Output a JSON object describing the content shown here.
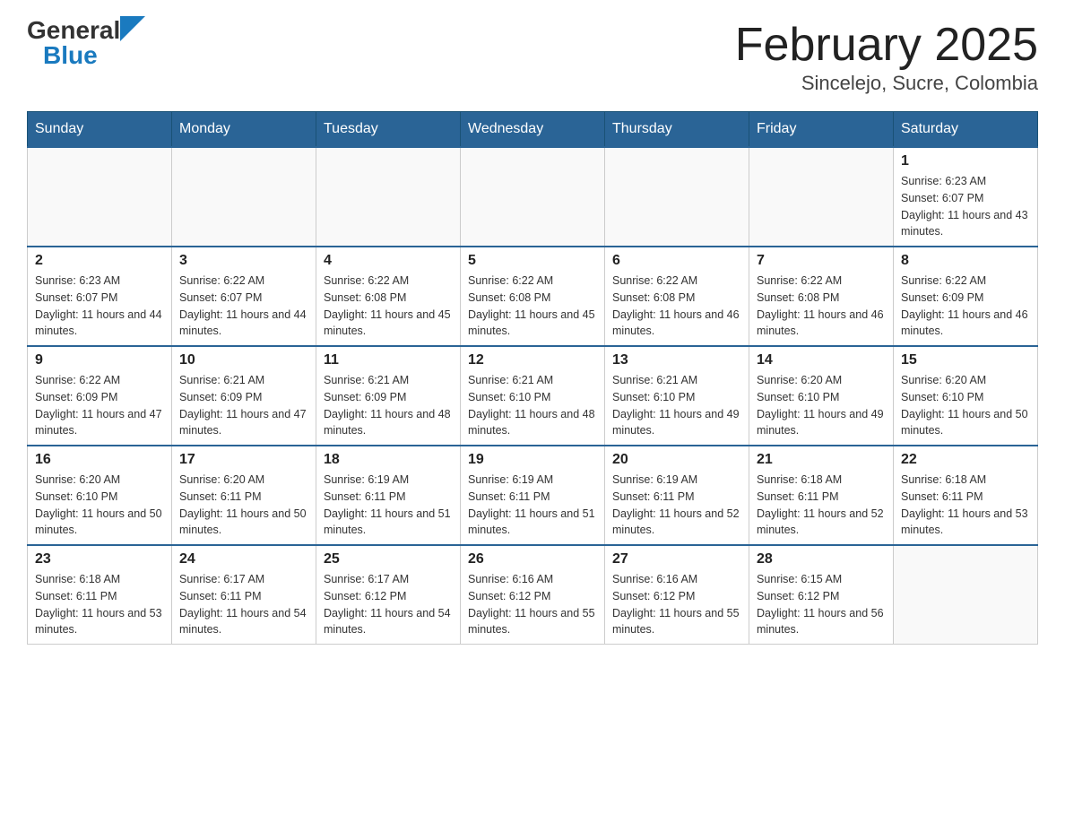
{
  "logo": {
    "general": "General",
    "blue": "Blue"
  },
  "title": "February 2025",
  "subtitle": "Sincelejo, Sucre, Colombia",
  "weekdays": [
    "Sunday",
    "Monday",
    "Tuesday",
    "Wednesday",
    "Thursday",
    "Friday",
    "Saturday"
  ],
  "weeks": [
    [
      {
        "day": "",
        "info": ""
      },
      {
        "day": "",
        "info": ""
      },
      {
        "day": "",
        "info": ""
      },
      {
        "day": "",
        "info": ""
      },
      {
        "day": "",
        "info": ""
      },
      {
        "day": "",
        "info": ""
      },
      {
        "day": "1",
        "info": "Sunrise: 6:23 AM\nSunset: 6:07 PM\nDaylight: 11 hours and 43 minutes."
      }
    ],
    [
      {
        "day": "2",
        "info": "Sunrise: 6:23 AM\nSunset: 6:07 PM\nDaylight: 11 hours and 44 minutes."
      },
      {
        "day": "3",
        "info": "Sunrise: 6:22 AM\nSunset: 6:07 PM\nDaylight: 11 hours and 44 minutes."
      },
      {
        "day": "4",
        "info": "Sunrise: 6:22 AM\nSunset: 6:08 PM\nDaylight: 11 hours and 45 minutes."
      },
      {
        "day": "5",
        "info": "Sunrise: 6:22 AM\nSunset: 6:08 PM\nDaylight: 11 hours and 45 minutes."
      },
      {
        "day": "6",
        "info": "Sunrise: 6:22 AM\nSunset: 6:08 PM\nDaylight: 11 hours and 46 minutes."
      },
      {
        "day": "7",
        "info": "Sunrise: 6:22 AM\nSunset: 6:08 PM\nDaylight: 11 hours and 46 minutes."
      },
      {
        "day": "8",
        "info": "Sunrise: 6:22 AM\nSunset: 6:09 PM\nDaylight: 11 hours and 46 minutes."
      }
    ],
    [
      {
        "day": "9",
        "info": "Sunrise: 6:22 AM\nSunset: 6:09 PM\nDaylight: 11 hours and 47 minutes."
      },
      {
        "day": "10",
        "info": "Sunrise: 6:21 AM\nSunset: 6:09 PM\nDaylight: 11 hours and 47 minutes."
      },
      {
        "day": "11",
        "info": "Sunrise: 6:21 AM\nSunset: 6:09 PM\nDaylight: 11 hours and 48 minutes."
      },
      {
        "day": "12",
        "info": "Sunrise: 6:21 AM\nSunset: 6:10 PM\nDaylight: 11 hours and 48 minutes."
      },
      {
        "day": "13",
        "info": "Sunrise: 6:21 AM\nSunset: 6:10 PM\nDaylight: 11 hours and 49 minutes."
      },
      {
        "day": "14",
        "info": "Sunrise: 6:20 AM\nSunset: 6:10 PM\nDaylight: 11 hours and 49 minutes."
      },
      {
        "day": "15",
        "info": "Sunrise: 6:20 AM\nSunset: 6:10 PM\nDaylight: 11 hours and 50 minutes."
      }
    ],
    [
      {
        "day": "16",
        "info": "Sunrise: 6:20 AM\nSunset: 6:10 PM\nDaylight: 11 hours and 50 minutes."
      },
      {
        "day": "17",
        "info": "Sunrise: 6:20 AM\nSunset: 6:11 PM\nDaylight: 11 hours and 50 minutes."
      },
      {
        "day": "18",
        "info": "Sunrise: 6:19 AM\nSunset: 6:11 PM\nDaylight: 11 hours and 51 minutes."
      },
      {
        "day": "19",
        "info": "Sunrise: 6:19 AM\nSunset: 6:11 PM\nDaylight: 11 hours and 51 minutes."
      },
      {
        "day": "20",
        "info": "Sunrise: 6:19 AM\nSunset: 6:11 PM\nDaylight: 11 hours and 52 minutes."
      },
      {
        "day": "21",
        "info": "Sunrise: 6:18 AM\nSunset: 6:11 PM\nDaylight: 11 hours and 52 minutes."
      },
      {
        "day": "22",
        "info": "Sunrise: 6:18 AM\nSunset: 6:11 PM\nDaylight: 11 hours and 53 minutes."
      }
    ],
    [
      {
        "day": "23",
        "info": "Sunrise: 6:18 AM\nSunset: 6:11 PM\nDaylight: 11 hours and 53 minutes."
      },
      {
        "day": "24",
        "info": "Sunrise: 6:17 AM\nSunset: 6:11 PM\nDaylight: 11 hours and 54 minutes."
      },
      {
        "day": "25",
        "info": "Sunrise: 6:17 AM\nSunset: 6:12 PM\nDaylight: 11 hours and 54 minutes."
      },
      {
        "day": "26",
        "info": "Sunrise: 6:16 AM\nSunset: 6:12 PM\nDaylight: 11 hours and 55 minutes."
      },
      {
        "day": "27",
        "info": "Sunrise: 6:16 AM\nSunset: 6:12 PM\nDaylight: 11 hours and 55 minutes."
      },
      {
        "day": "28",
        "info": "Sunrise: 6:15 AM\nSunset: 6:12 PM\nDaylight: 11 hours and 56 minutes."
      },
      {
        "day": "",
        "info": ""
      }
    ]
  ]
}
